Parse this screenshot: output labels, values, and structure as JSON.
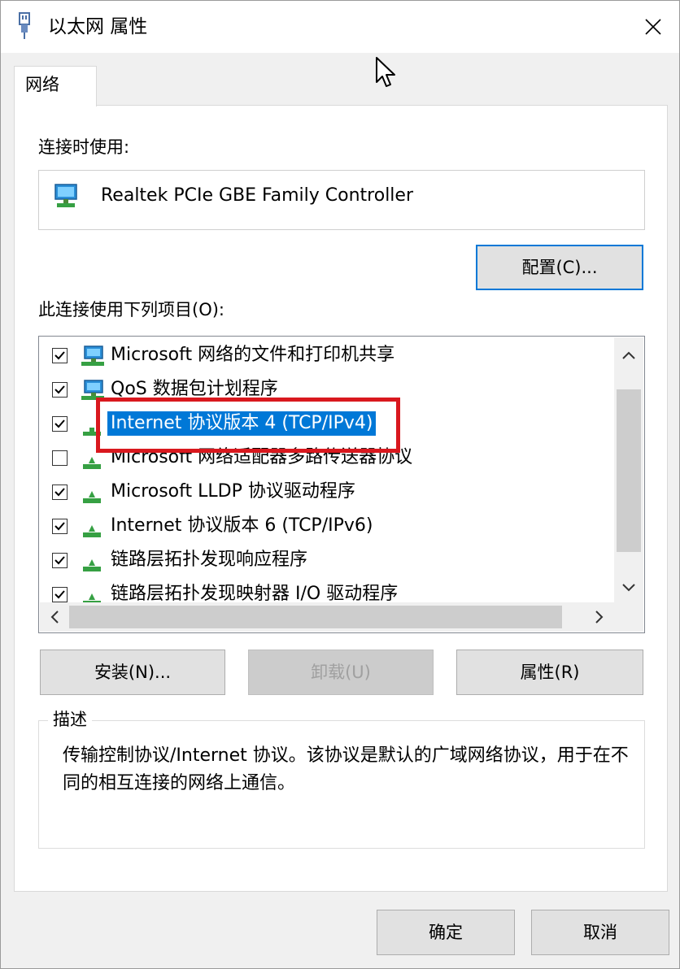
{
  "window": {
    "title": "以太网 属性",
    "close_glyph": "✕"
  },
  "tabs": [
    {
      "label": "网络",
      "active": true
    }
  ],
  "connect_using": {
    "label": "连接时使用:",
    "adapter_name": "Realtek PCIe GBE Family Controller",
    "adapter_icon": "network-adapter-icon"
  },
  "configure_button": {
    "label": "配置(C)..."
  },
  "items_section": {
    "label": "此连接使用下列项目(O):",
    "items": [
      {
        "label": "Microsoft 网络的文件和打印机共享",
        "checked": true,
        "selected": false,
        "icon": "network-client-icon"
      },
      {
        "label": "QoS 数据包计划程序",
        "checked": true,
        "selected": false,
        "icon": "network-client-icon"
      },
      {
        "label": "Internet 协议版本 4 (TCP/IPv4)",
        "checked": true,
        "selected": true,
        "icon": "protocol-icon"
      },
      {
        "label": "Microsoft 网络适配器多路传送器协议",
        "checked": false,
        "selected": false,
        "icon": "protocol-icon"
      },
      {
        "label": "Microsoft LLDP 协议驱动程序",
        "checked": true,
        "selected": false,
        "icon": "protocol-icon"
      },
      {
        "label": "Internet 协议版本 6 (TCP/IPv6)",
        "checked": true,
        "selected": false,
        "icon": "protocol-icon"
      },
      {
        "label": "链路层拓扑发现响应程序",
        "checked": true,
        "selected": false,
        "icon": "protocol-icon"
      },
      {
        "label": "链路层拓扑发现映射器 I/O 驱动程序",
        "checked": true,
        "selected": false,
        "icon": "protocol-icon"
      }
    ]
  },
  "action_buttons": {
    "install": "安装(N)...",
    "uninstall": "卸载(U)",
    "properties": "属性(R)"
  },
  "description": {
    "legend": "描述",
    "text": "传输控制协议/Internet 协议。该协议是默认的广域网络协议，用于在不同的相互连接的网络上通信。"
  },
  "footer": {
    "ok": "确定",
    "cancel": "取消"
  },
  "colors": {
    "selection": "#0078d7",
    "highlight_box": "#d9181e",
    "window_bg": "#f0f0f0"
  }
}
